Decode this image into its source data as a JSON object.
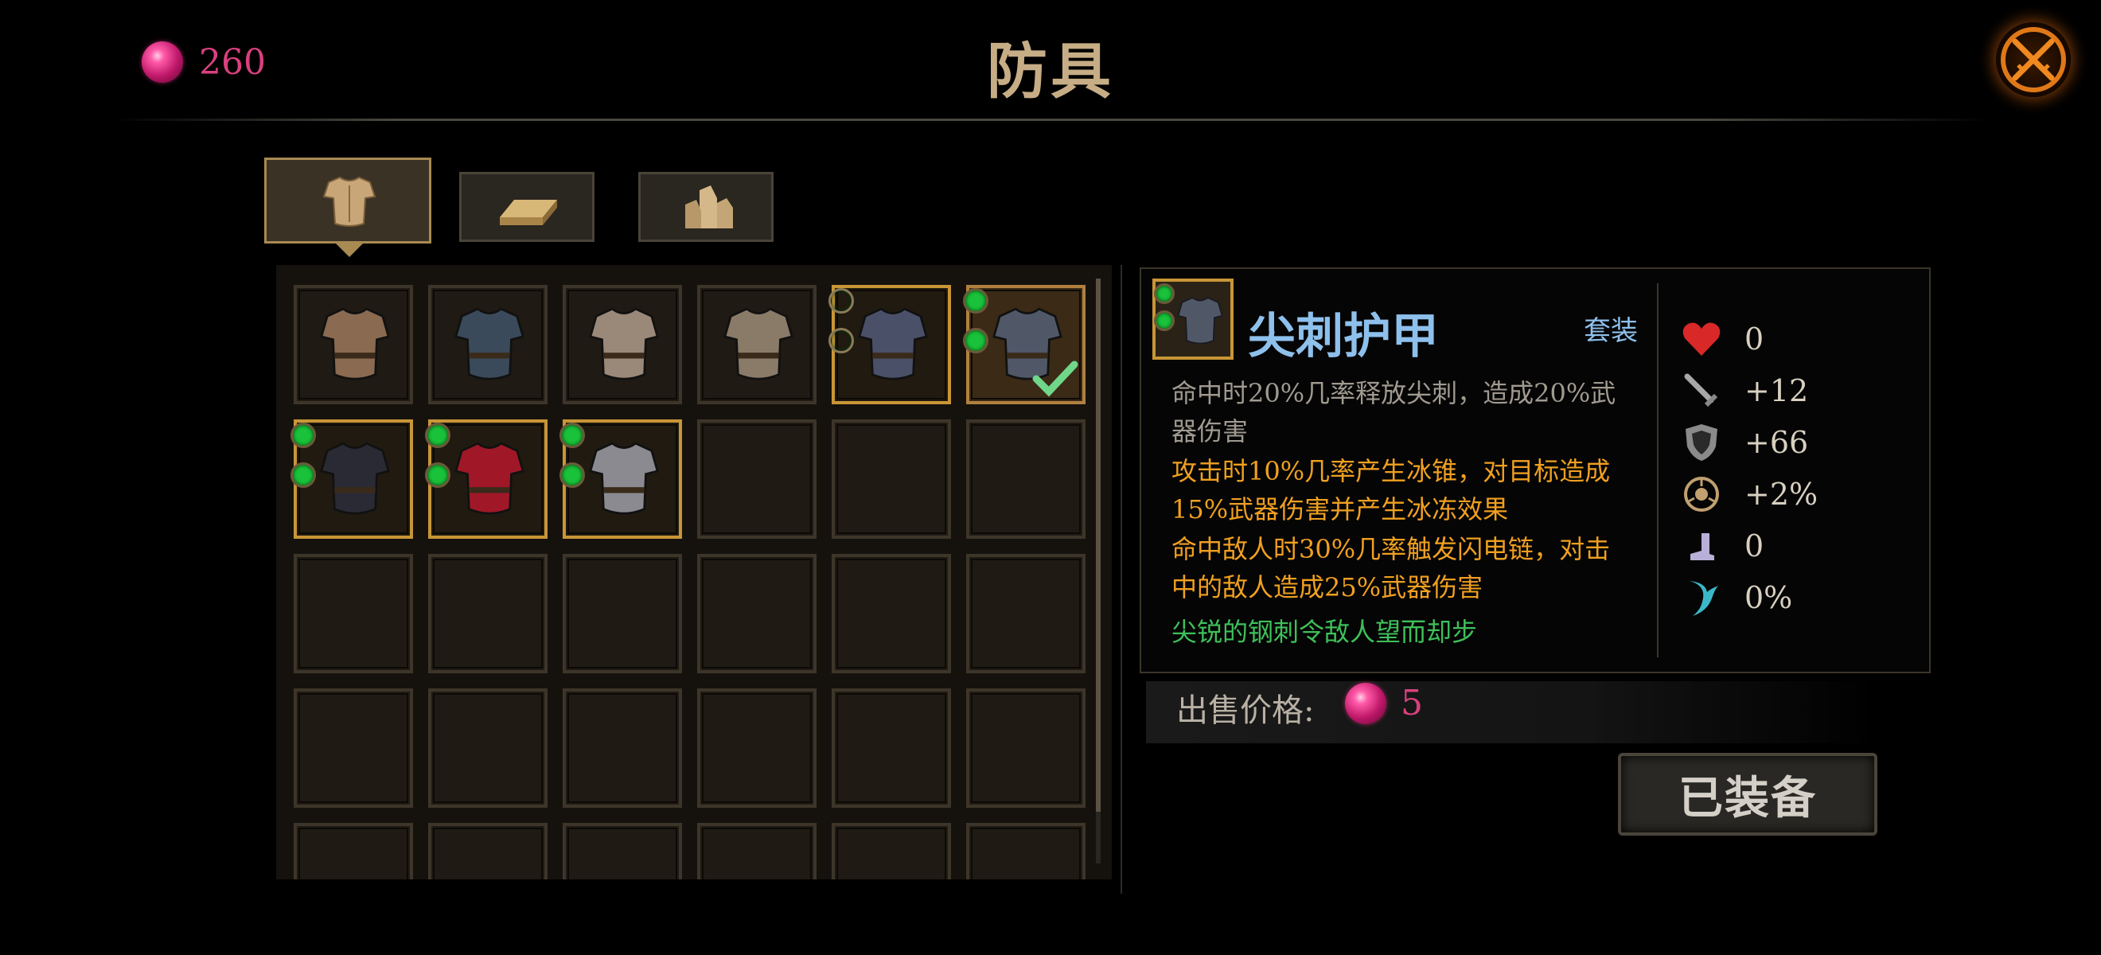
{
  "header": {
    "title": "防具",
    "currency": {
      "icon": "pink-gem-icon",
      "value": "260"
    },
    "close_icon": "crossed-swords-close-icon"
  },
  "tabs": [
    {
      "name": "armor",
      "icon": "armor-icon",
      "active": true
    },
    {
      "name": "materials",
      "icon": "gold-bar-icon",
      "active": false
    },
    {
      "name": "crystals",
      "icon": "crystal-icon",
      "active": false
    }
  ],
  "inventory": {
    "slots": [
      {
        "item": "leather armor",
        "color": "#8a6a50",
        "gems": 0
      },
      {
        "item": "dark vest",
        "color": "#3a4a5a",
        "gems": 0
      },
      {
        "item": "plated armor",
        "color": "#9a8878",
        "gems": 0
      },
      {
        "item": "chain armor",
        "color": "#8a7a68",
        "gems": 0
      },
      {
        "item": "steel set armor",
        "color": "#4a5068",
        "gems": 2,
        "gem_state": "empty",
        "set": true
      },
      {
        "item": "spiked armor",
        "color": "#505868",
        "gems": 2,
        "gem_state": "filled",
        "set": true,
        "equipped": true
      },
      {
        "item": "shadow armor",
        "color": "#2a2a35",
        "gems": 2,
        "gem_state": "filled",
        "set": true
      },
      {
        "item": "crimson armor",
        "color": "#a01828",
        "gems": 2,
        "gem_state": "filled",
        "set": true
      },
      {
        "item": "silver armor",
        "color": "#8a8a90",
        "gems": 2,
        "gem_state": "filled",
        "set": true
      }
    ]
  },
  "detail": {
    "name": "尖刺护甲",
    "set_label": "套装",
    "effect_base": "命中时20%几率释放尖刺，造成20%武器伤害",
    "effect_1": "攻击时10%几率产生冰锥，对目标造成15%武器伤害并产生冰冻效果",
    "effect_2": "命中敌人时30%几率触发闪电链，对击中的敌人造成25%武器伤害",
    "flavor": "尖锐的钢刺令敌人望而却步",
    "stats": [
      {
        "icon": "heart-icon",
        "value": "0"
      },
      {
        "icon": "sword-icon",
        "value": "+12"
      },
      {
        "icon": "shield-icon",
        "value": "+66"
      },
      {
        "icon": "crit-icon",
        "value": "+2%"
      },
      {
        "icon": "boot-icon",
        "value": "0"
      },
      {
        "icon": "claw-icon",
        "value": "0%"
      }
    ]
  },
  "sell": {
    "label": "出售价格:",
    "value": "5"
  },
  "equip_button": "已装备"
}
